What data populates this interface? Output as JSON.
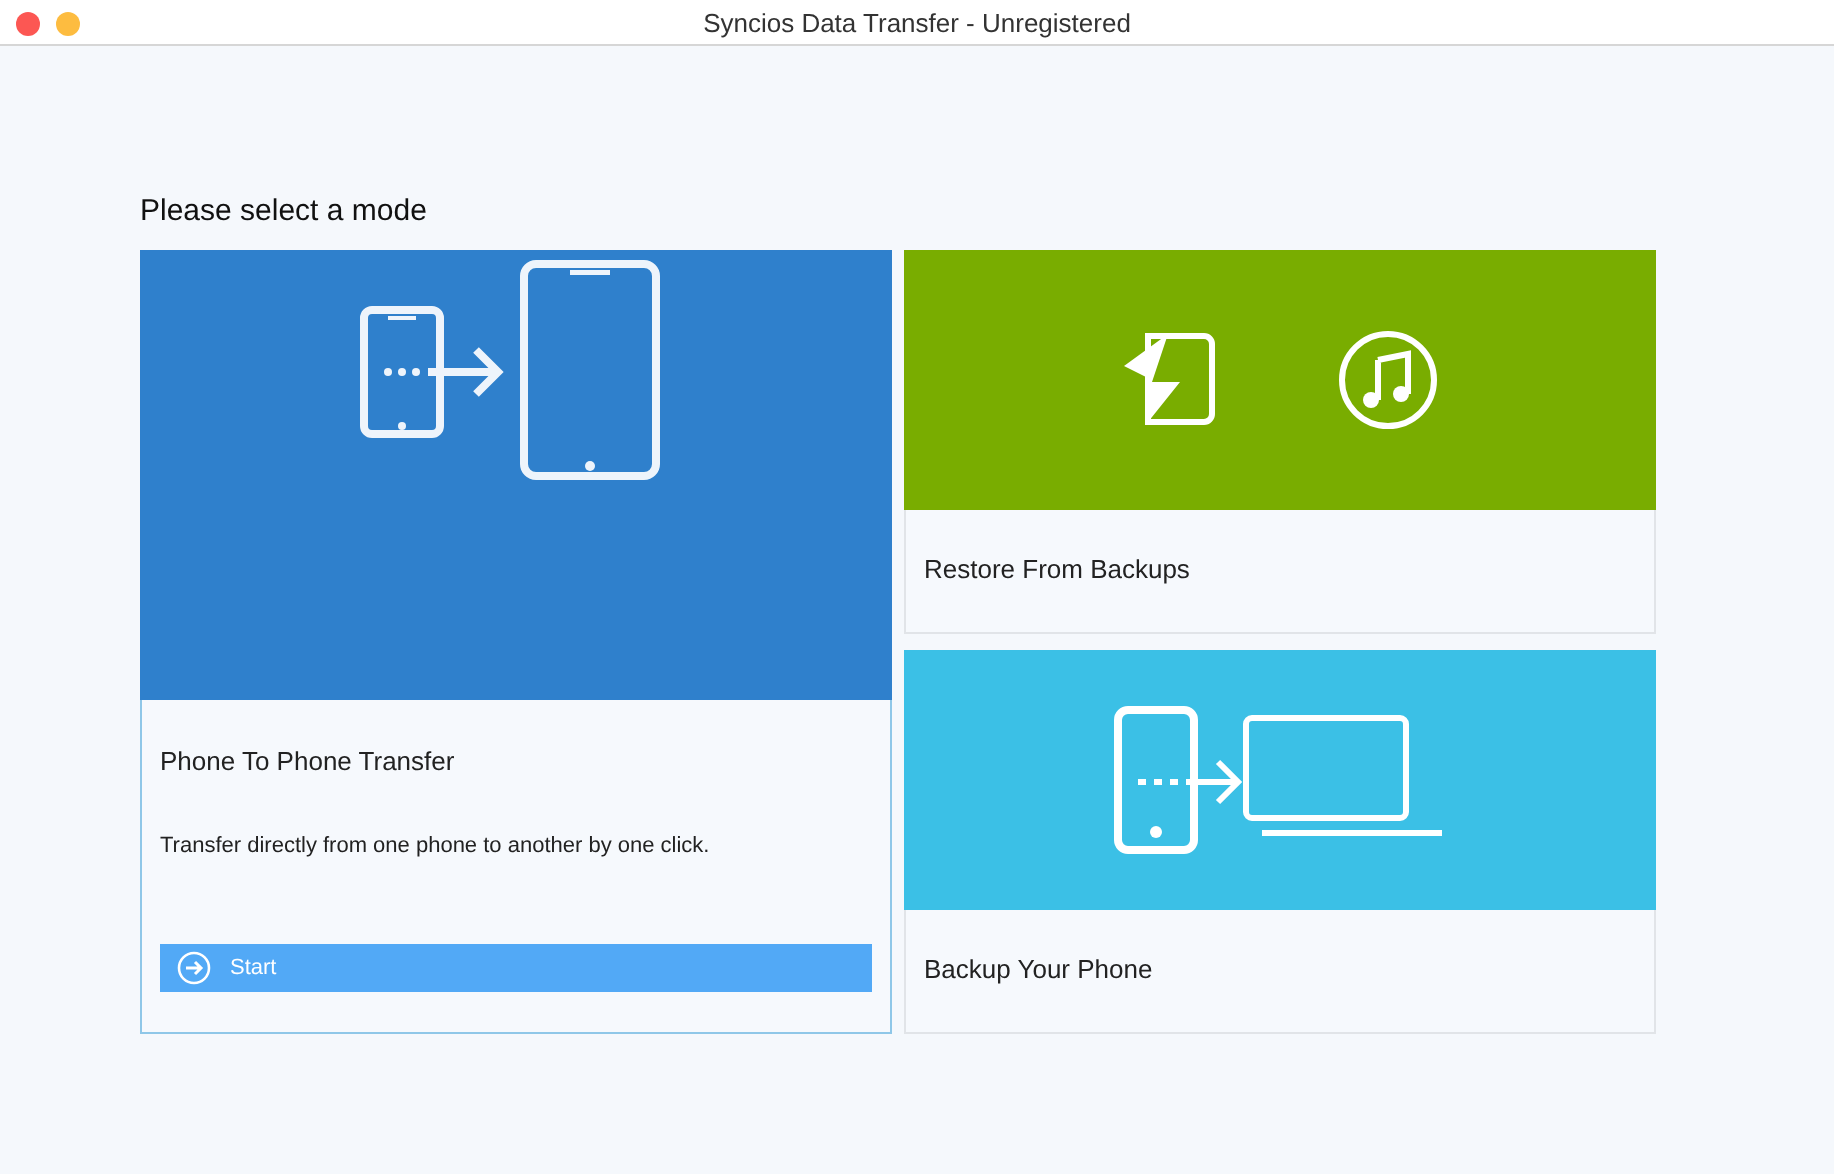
{
  "window": {
    "title": "Syncios Data Transfer - Unregistered"
  },
  "heading": "Please select a mode",
  "modes": [
    {
      "kind": "phone-to-phone",
      "title": "Phone To Phone Transfer",
      "selected": true,
      "description": "Transfer directly from one phone to another by one click.",
      "button": "Start"
    },
    {
      "kind": "restore",
      "title": "Restore From Backups",
      "selected": false
    },
    {
      "kind": "backup",
      "title": "Backup Your Phone",
      "selected": false
    }
  ]
}
